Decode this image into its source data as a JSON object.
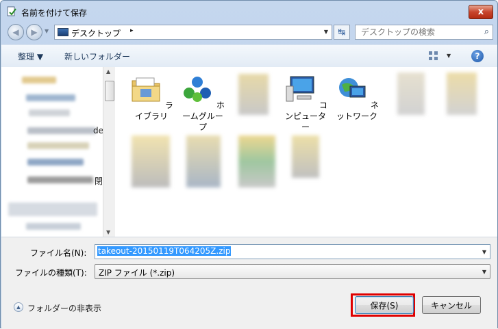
{
  "window": {
    "title": "名前を付けて保存",
    "close": "x"
  },
  "nav": {
    "back": "◀",
    "forward": "▶",
    "drop": "▼"
  },
  "address": {
    "location": "デスクトップ",
    "separator": "▸",
    "drop": "▼"
  },
  "refresh": {
    "glyph": "↹"
  },
  "search": {
    "placeholder": "デスクトップの検索",
    "glyph": "⌕"
  },
  "toolbar": {
    "organize": "整理 ▼",
    "new_folder": "新しいフォルダー",
    "view_drop": "▼",
    "help": "?"
  },
  "files": [
    {
      "label": "ライブラリ",
      "icon": "library-icon"
    },
    {
      "label": "ホームグループ",
      "icon": "homegroup-icon"
    },
    {
      "label": "コンピューター",
      "icon": "computer-icon"
    },
    {
      "label": "ネットワーク",
      "icon": "network-icon"
    }
  ],
  "nav_pane": {
    "partial_label_1": "de",
    "partial_label_2": "閉",
    "up": "▲",
    "down": "▼"
  },
  "form": {
    "filename_label": "ファイル名(N):",
    "filename_value": "takeout-20150119T064205Z.zip",
    "filetype_label": "ファイルの種類(T):",
    "filetype_value": "ZIP ファイル (*.zip)",
    "drop": "▼"
  },
  "footer": {
    "hide_folders": "フォルダーの非表示",
    "hide_glyph": "▲",
    "save": "保存(S)",
    "cancel": "キャンセル"
  },
  "colors": {
    "highlight": "#e00000",
    "selection": "#3399ff"
  }
}
